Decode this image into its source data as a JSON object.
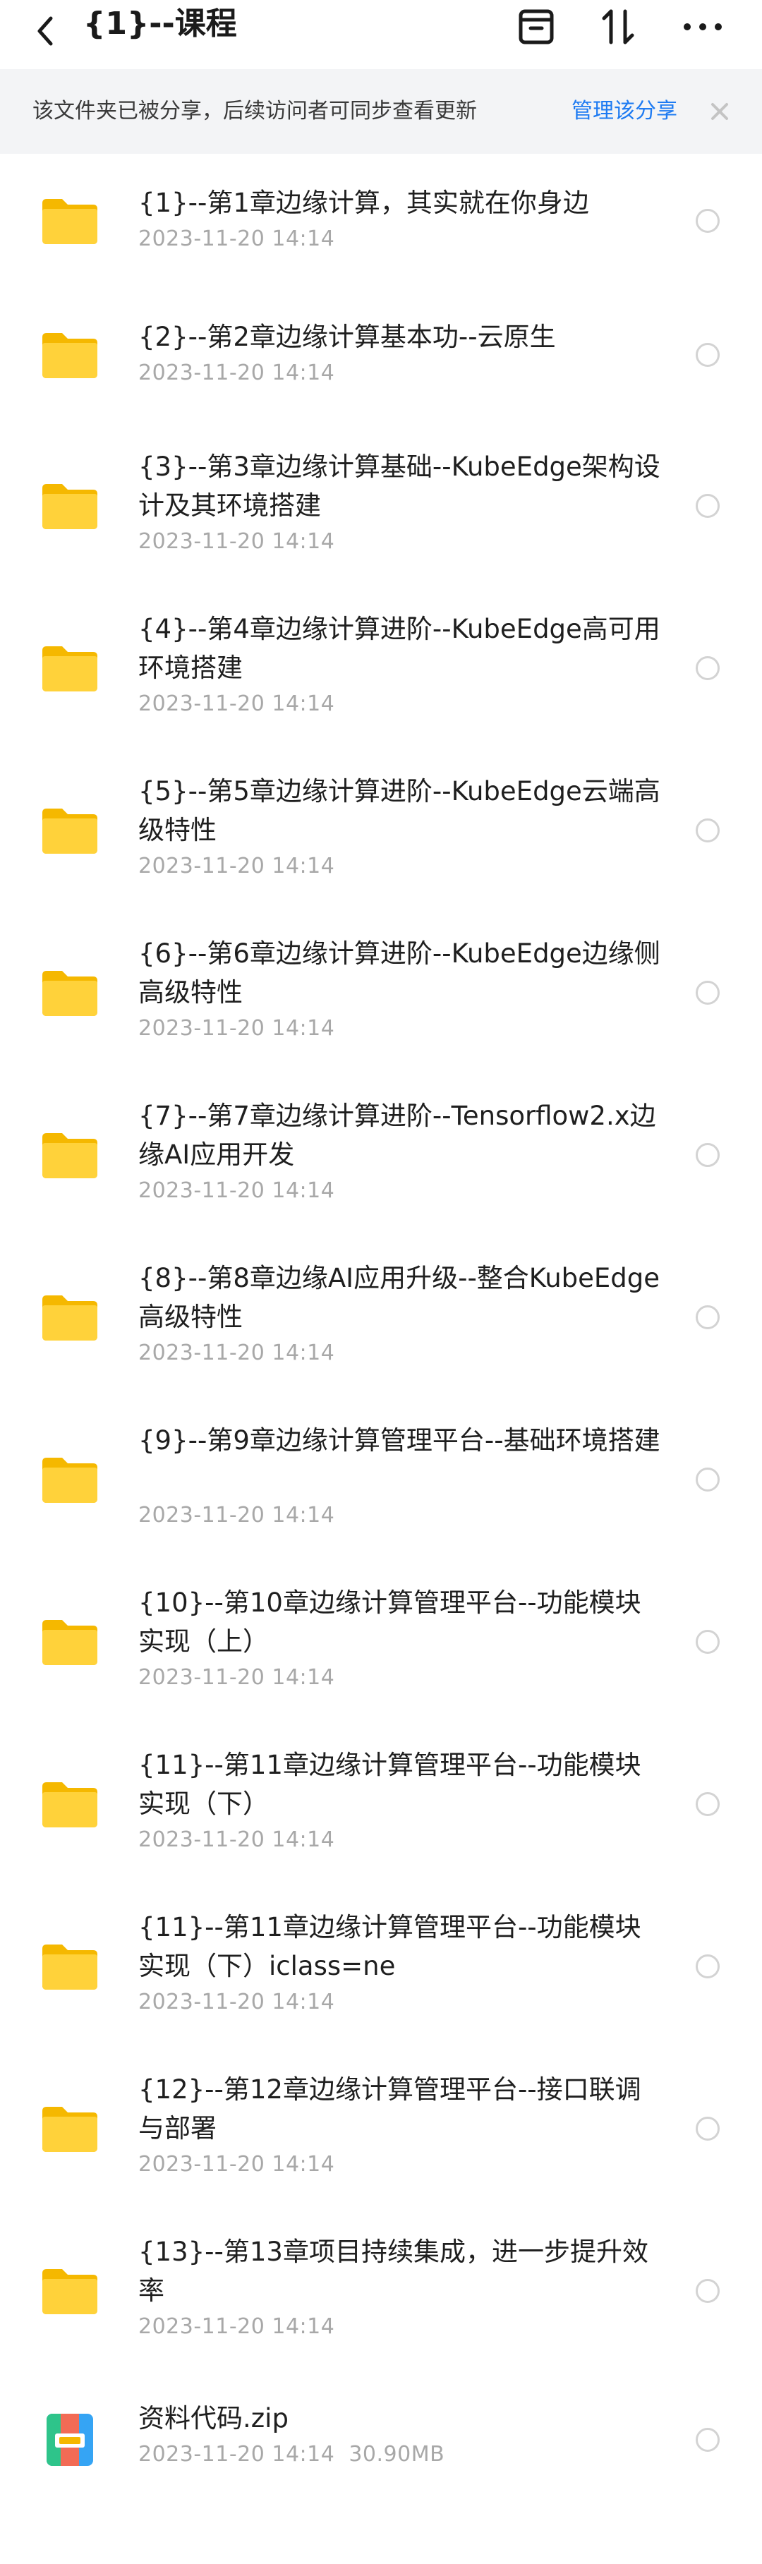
{
  "header": {
    "title": "{1}--课程"
  },
  "banner": {
    "text": "该文件夹已被分享，后续访问者可同步查看更新",
    "link": "管理该分享"
  },
  "items": [
    {
      "type": "folder",
      "name": "{1}--第1章边缘计算，其实就在你身边",
      "date": "2023-11-20  14:14",
      "size": ""
    },
    {
      "type": "folder",
      "name": "{2}--第2章边缘计算基本功--云原生",
      "date": "2023-11-20  14:14",
      "size": ""
    },
    {
      "type": "folder",
      "name": "{3}--第3章边缘计算基础--KubeEdge架构设计及其环境搭建",
      "date": "2023-11-20  14:14",
      "size": ""
    },
    {
      "type": "folder",
      "name": "{4}--第4章边缘计算进阶--KubeEdge高可用环境搭建",
      "date": "2023-11-20  14:14",
      "size": ""
    },
    {
      "type": "folder",
      "name": "{5}--第5章边缘计算进阶--KubeEdge云端高级特性",
      "date": "2023-11-20  14:14",
      "size": ""
    },
    {
      "type": "folder",
      "name": "{6}--第6章边缘计算进阶--KubeEdge边缘侧高级特性",
      "date": "2023-11-20  14:14",
      "size": ""
    },
    {
      "type": "folder",
      "name": "{7}--第7章边缘计算进阶--Tensorflow2.x边缘AI应用开发",
      "date": "2023-11-20  14:14",
      "size": ""
    },
    {
      "type": "folder",
      "name": "{8}--第8章边缘AI应用升级--整合KubeEdge高级特性",
      "date": "2023-11-20  14:14",
      "size": ""
    },
    {
      "type": "folder",
      "name": "{9}--第9章边缘计算管理平台--基础环境搭建",
      "date": "2023-11-20  14:14",
      "size": ""
    },
    {
      "type": "folder",
      "name": "{10}--第10章边缘计算管理平台--功能模块实现（上）",
      "date": "2023-11-20  14:14",
      "size": ""
    },
    {
      "type": "folder",
      "name": "{11}--第11章边缘计算管理平台--功能模块实现（下）",
      "date": "2023-11-20  14:14",
      "size": ""
    },
    {
      "type": "folder",
      "name": "{11}--第11章边缘计算管理平台--功能模块实现（下）iclass=ne",
      "date": "2023-11-20  14:14",
      "size": ""
    },
    {
      "type": "folder",
      "name": "{12}--第12章边缘计算管理平台--接口联调与部署",
      "date": "2023-11-20  14:14",
      "size": ""
    },
    {
      "type": "folder",
      "name": "{13}--第13章项目持续集成，进一步提升效率",
      "date": "2023-11-20  14:14",
      "size": ""
    },
    {
      "type": "zip",
      "name": "资料代码.zip",
      "date": "2023-11-20  14:14",
      "size": "30.90MB"
    }
  ]
}
